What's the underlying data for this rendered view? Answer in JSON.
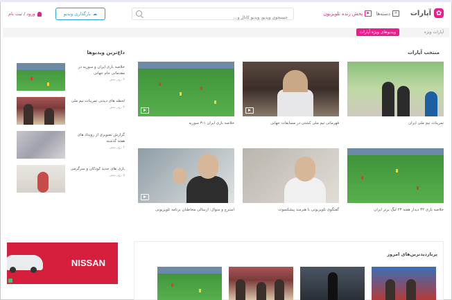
{
  "header": {
    "logo_text": "آپارات",
    "nav": [
      {
        "label": "دسته‌ها",
        "icon": "menu-icon"
      },
      {
        "label": "پخش زنده تلویزیون",
        "icon": "tv-icon"
      }
    ],
    "search_placeholder": "جستجوی ویدیو، ویدیو کانال و...",
    "upload_label": "بارگذاری ویدیو",
    "login_label": "ورود / ثبت نام"
  },
  "subbar": {
    "breadcrumb": "آپارات ویژه",
    "tag": "ویدیوهای ویژه آپارات"
  },
  "main": {
    "section_title": "منتخب آپارات",
    "cards": [
      {
        "caption": "تمرینات تیم ملی ایران",
        "thumb": "street"
      },
      {
        "caption": "قهرمانی تیم ملی کشتی در مسابقات جهانی",
        "thumb": "gym"
      },
      {
        "caption": "خلاصه بازی ایران ۱-۳ سوریه",
        "thumb": "pitch"
      },
      {
        "caption": "خلاصه بازی ۳۲ دیدار هفته ۲۳ لیگ برتر ایران",
        "thumb": "pitch"
      },
      {
        "caption": "گفتگوی تلویزیونی با هنرمند پیشکسوت",
        "thumb": "portrait"
      },
      {
        "caption": "استرچ و سوال: ارسالی مخاطبان برنامه تلویزیونی",
        "thumb": "kid"
      }
    ]
  },
  "side": {
    "section_title": "داغ‌ترین ویدیوها",
    "items": [
      {
        "title": "خلاصه بازی ایران و سوریه در مقدماتی جام جهانی",
        "meta": "۲ روز پیش",
        "thumb": "pitch"
      },
      {
        "title": "لحظه های دیدنی تمرینات تیم ملی",
        "meta": "۳ روز پیش",
        "thumb": "crowd"
      },
      {
        "title": "گزارش تصویری از رویداد های هفته گذشته",
        "meta": "۴ روز پیش",
        "thumb": "blur"
      },
      {
        "title": "بازی های جدید کودکان و سرگرمی",
        "meta": "۵ روز پیش",
        "thumb": "kid"
      }
    ]
  },
  "ad": {
    "brand": "NISSAN"
  },
  "bottom": {
    "section_title": "پربازدیدترین‌های امروز",
    "thumbs": [
      "pitch",
      "crowd",
      "crowd",
      "crowd"
    ]
  }
}
